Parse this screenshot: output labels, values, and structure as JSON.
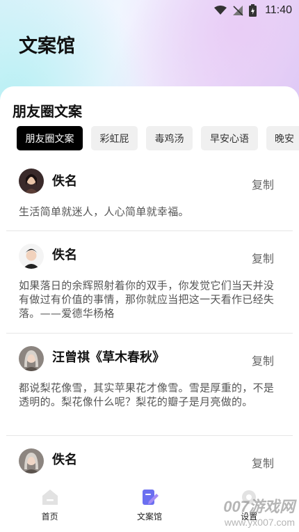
{
  "status_bar": {
    "time": "11:40"
  },
  "header": {
    "title": "文案馆"
  },
  "section": {
    "title": "朋友圈文案"
  },
  "chips": [
    {
      "label": "朋友圈文案",
      "active": true
    },
    {
      "label": "彩虹屁",
      "active": false
    },
    {
      "label": "毒鸡汤",
      "active": false
    },
    {
      "label": "早安心语",
      "active": false
    },
    {
      "label": "晚安",
      "active": false
    }
  ],
  "cards": [
    {
      "author": "佚名",
      "copy_label": "复制",
      "content": "生活简单就迷人，人心简单就幸福。"
    },
    {
      "author": "佚名",
      "copy_label": "复制",
      "content": "如果落日的余辉照射着你的双手，你发觉它们当天并没有做过有价值的事情，那你就应当把这一天看作已经失落。——爱德华杨格"
    },
    {
      "author": "汪曾祺《草木春秋》",
      "copy_label": "复制",
      "content": "都说梨花像雪，其实苹果花才像雪。雪是厚重的，不是透明的。梨花像什么呢？梨花的瓣子是月亮做的。"
    },
    {
      "author": "佚名",
      "copy_label": "复制",
      "content": ""
    }
  ],
  "tabbar": {
    "home": "首页",
    "library": "文案馆",
    "settings": "设置",
    "active_color": "#6b6ff0"
  },
  "watermark": {
    "line1": "007游戏网",
    "line2": "www.yx007.com"
  }
}
